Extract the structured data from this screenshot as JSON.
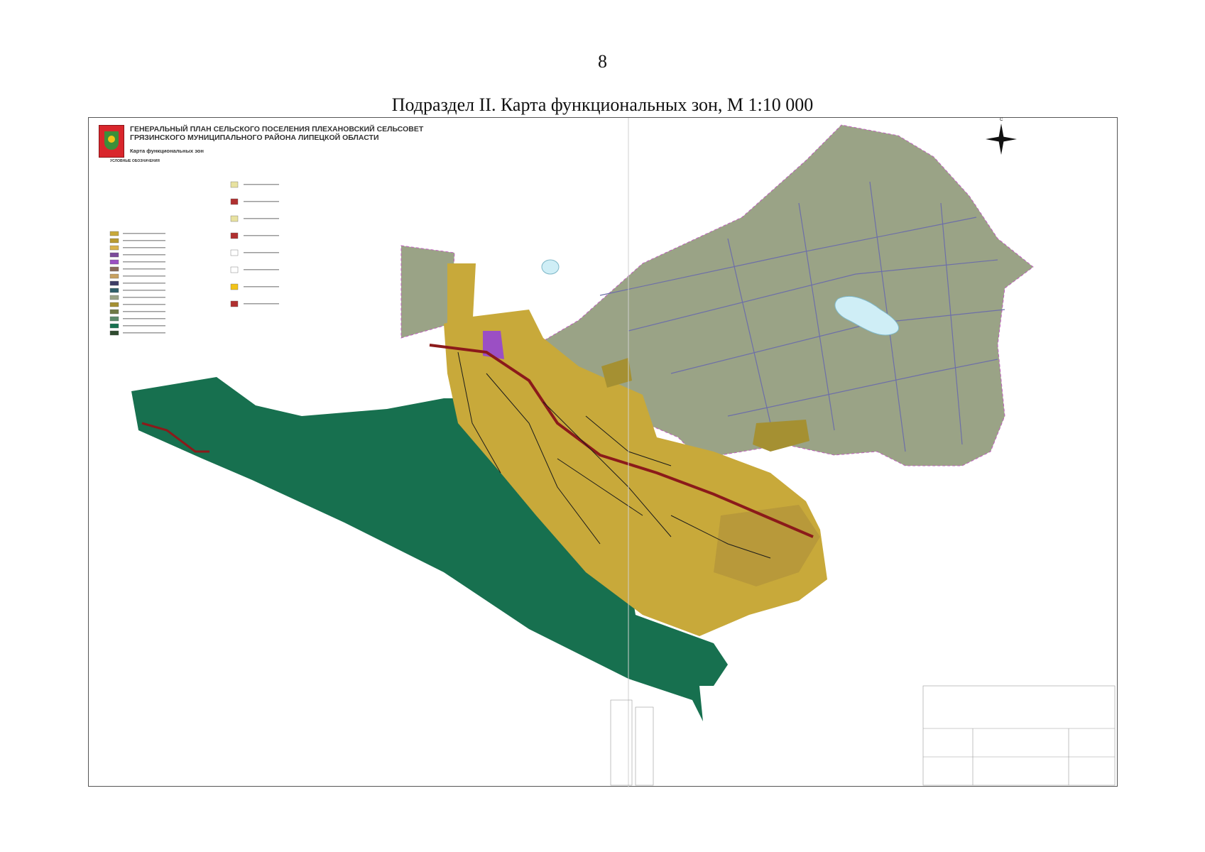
{
  "page": {
    "number": "8",
    "section_title": "Подраздел II. Карта функциональных зон, М 1:10 000"
  },
  "map": {
    "header_line1": "ГЕНЕРАЛЬНЫЙ ПЛАН СЕЛЬСКОГО ПОСЕЛЕНИЯ ПЛЕХАНОВСКИЙ СЕЛЬСОВЕТ",
    "header_line2": "ГРЯЗИНСКОГО МУНИЦИПАЛЬНОГО РАЙОНА ЛИПЕЦКОЙ ОБЛАСТИ",
    "subtitle": "Карта функциональных зон",
    "legend_title": "УСЛОВНЫЕ ОБОЗНАЧЕНИЯ",
    "north_label": "С",
    "colors": {
      "agricultural": "#9aa386",
      "forest": "#17704f",
      "residential": "#c8a93a",
      "road": "#8b1a1a",
      "water": "#cfeef6",
      "industrial": "#a59032",
      "public": "#9b4fc4",
      "engineering": "#3d3d66"
    },
    "legend_swatches": [
      "#c8a93a",
      "#b89a30",
      "#d9b24a",
      "#7b4a9a",
      "#9b4fc4",
      "#8a6a5a",
      "#c8a060",
      "#3d3d66",
      "#2f5f6a",
      "#9aa386",
      "#a59032",
      "#6f7a45",
      "#5a8a6a",
      "#17704f",
      "#2f4a2f"
    ],
    "legend_swatches2": [
      "#e8e2a0",
      "#b03030",
      "#e8e2a0",
      "#b03030",
      "#ffffff",
      "#ffffff",
      "#f2c318",
      "#b03030"
    ]
  }
}
